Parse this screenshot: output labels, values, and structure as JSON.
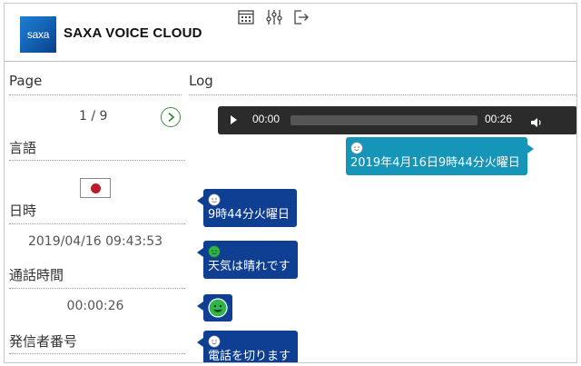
{
  "app": {
    "logo_text": "saxa",
    "title": "SAXA VOICE CLOUD",
    "icons": [
      "calendar-icon",
      "sliders-icon",
      "logout-icon"
    ]
  },
  "columns": {
    "page": "Page",
    "log": "Log"
  },
  "pager": {
    "text": "1 / 9"
  },
  "details": {
    "language_label": "言語",
    "language_flag": "japan-flag-icon",
    "datetime_label": "日時",
    "datetime_value": "2019/04/16 09:43:53",
    "duration_label": "通話時間",
    "duration_value": "00:00:26",
    "caller_label": "発信者番号"
  },
  "player": {
    "current_time": "00:00",
    "total_time": "00:26",
    "progress": 0.0
  },
  "log": [
    {
      "side": "right",
      "speaker": "white-face-icon",
      "text": "2019年4月16日9時44分火曜日"
    },
    {
      "side": "left",
      "speaker": "white-face-icon",
      "text": "9時44分火曜日"
    },
    {
      "side": "left",
      "speaker": "green-face-icon",
      "text": "天気は晴れです"
    },
    {
      "side": "left",
      "speaker": "green-face-icon",
      "text": ""
    },
    {
      "side": "left",
      "speaker": "white-face-icon",
      "text": "電話を切ります"
    }
  ],
  "colors": {
    "bubble_right": "#1595b8",
    "bubble_left": "#0e3f93",
    "player_bg": "#2b2b2b",
    "logo_blue": "#1466b8",
    "pager_green": "#3c8a3c"
  }
}
